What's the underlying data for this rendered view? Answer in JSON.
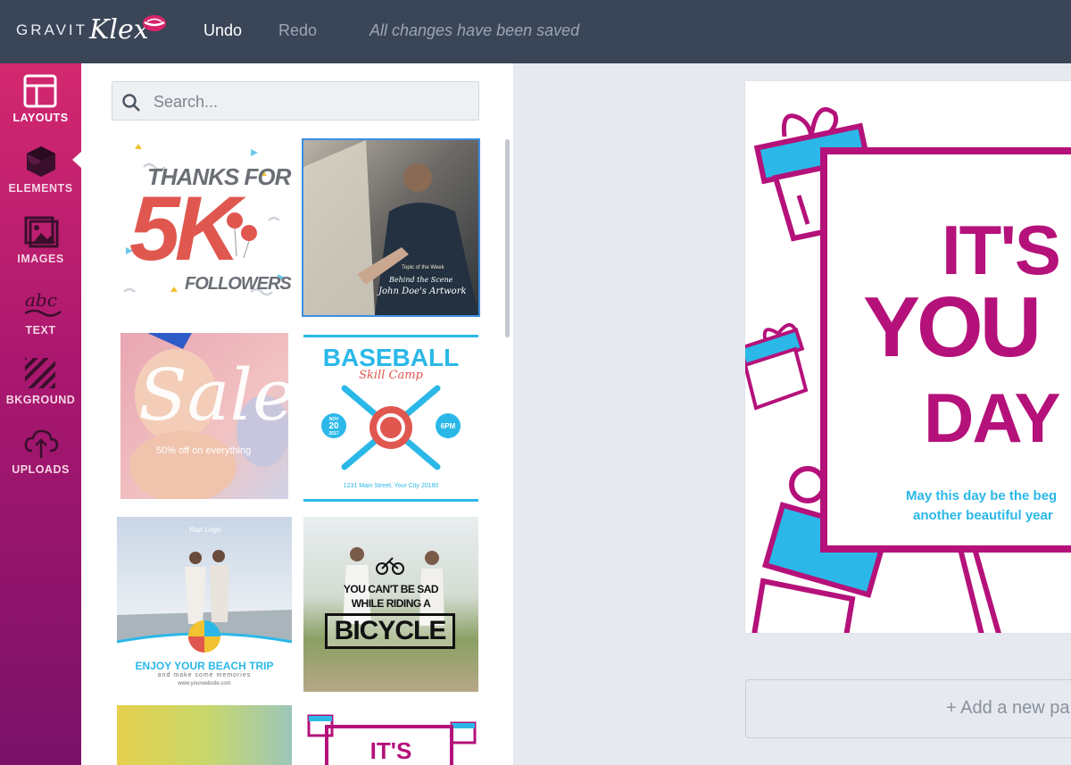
{
  "app": {
    "brand": "GRAVIT",
    "brand_script": "Klex",
    "icon": "lips-logo-icon"
  },
  "toolbar": {
    "undo_label": "Undo",
    "redo_label": "Redo",
    "status": "All changes have been saved"
  },
  "sidebar": {
    "items": [
      {
        "label": "LAYOUTS",
        "icon": "layout-icon",
        "active": true
      },
      {
        "label": "ELEMENTS",
        "icon": "shapes-icon"
      },
      {
        "label": "IMAGES",
        "icon": "image-icon"
      },
      {
        "label": "TEXT",
        "icon": "text-icon"
      },
      {
        "label": "BKGROUND",
        "icon": "pattern-icon"
      },
      {
        "label": "UPLOADS",
        "icon": "cloud-upload-icon"
      }
    ]
  },
  "search": {
    "placeholder": "Search..."
  },
  "templates": [
    {
      "lines": [
        "THANKS FOR",
        "5K",
        "FOLLOWERS"
      ]
    },
    {
      "lines": [
        "Topic of the Week",
        "Behind the Scene",
        "John Doe's Artwork"
      ]
    },
    {
      "lines": [
        "Sale",
        "50% off on everything"
      ]
    },
    {
      "lines": [
        "BASEBALL",
        "Skill Camp",
        "NOV",
        "20",
        "2017",
        "6PM",
        "1231 Main Street, Your City 20180"
      ]
    },
    {
      "lines": [
        "Your Logo",
        "ENJOY YOUR BEACH TRIP",
        "and make some memories",
        "www.yourwebsite.com"
      ]
    },
    {
      "lines": [
        "YOU CAN'T BE SAD",
        "WHILE RIDING A",
        "BICYCLE"
      ]
    },
    {
      "lines": []
    },
    {
      "lines": [
        "IT'S"
      ]
    }
  ],
  "artboard": {
    "line1": "IT'S",
    "line2": "YOU",
    "line3": "DAY",
    "sub1": "May this day be the beg",
    "sub2": "another beautiful year"
  },
  "add_page_label": "+ Add a new pa",
  "colors": {
    "topbar": "#3a4558",
    "magenta": "#b5117a",
    "cyan": "#2bb8e8",
    "sidebar_top": "#d3286f",
    "sidebar_bottom": "#7a1268",
    "selection": "#3d8ee0"
  }
}
